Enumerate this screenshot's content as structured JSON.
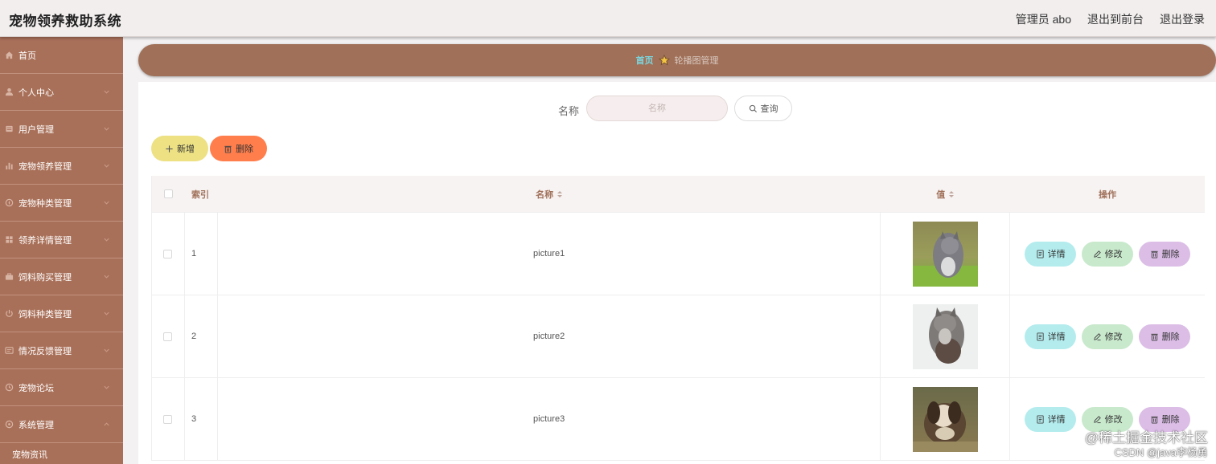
{
  "header": {
    "title": "宠物领养救助系统",
    "admin_label": "管理员 abo",
    "front_label": "退出到前台",
    "logout_label": "退出登录"
  },
  "sidebar": {
    "items": [
      {
        "label": "首页",
        "icon": "home-icon",
        "has_children": false
      },
      {
        "label": "个人中心",
        "icon": "user-icon",
        "has_children": true
      },
      {
        "label": "用户管理",
        "icon": "user-manage-icon",
        "has_children": true
      },
      {
        "label": "宠物领养管理",
        "icon": "bar-chart-icon",
        "has_children": true
      },
      {
        "label": "宠物种类管理",
        "icon": "compass-icon",
        "has_children": true
      },
      {
        "label": "领养详情管理",
        "icon": "grid-icon",
        "has_children": true
      },
      {
        "label": "饲料购买管理",
        "icon": "briefcase-icon",
        "has_children": true
      },
      {
        "label": "饲料种类管理",
        "icon": "power-icon",
        "has_children": true
      },
      {
        "label": "情况反馈管理",
        "icon": "message-icon",
        "has_children": true
      },
      {
        "label": "宠物论坛",
        "icon": "clock-icon",
        "has_children": true
      },
      {
        "label": "系统管理",
        "icon": "settings-icon",
        "has_children": true,
        "expanded": true
      }
    ],
    "sub_items": [
      {
        "label": "宠物资讯"
      }
    ]
  },
  "breadcrumb": {
    "home": "首页",
    "current": "轮播图管理",
    "separator_icon": "star-icon"
  },
  "search": {
    "label": "名称",
    "placeholder": "名称",
    "value": "",
    "button_label": "查询"
  },
  "actions": {
    "add_label": "新增",
    "delete_label": "删除"
  },
  "table": {
    "columns": [
      "索引",
      "名称",
      "值",
      "操作"
    ],
    "rows": [
      {
        "index": "1",
        "name": "picture1",
        "value": "cat-photo"
      },
      {
        "index": "2",
        "name": "picture2",
        "value": "cat-photo"
      },
      {
        "index": "3",
        "name": "picture3",
        "value": "dog-photo"
      }
    ],
    "row_actions": {
      "detail": "详情",
      "edit": "修改",
      "delete": "删除"
    }
  },
  "watermark": {
    "line1": "@稀土掘金技术社区",
    "line2": "CSDN @java李杨勇"
  },
  "colors": {
    "sidebar_bg": "#a97059",
    "breadcrumb_bg": "#a07058",
    "breadcrumb_home": "#7ad7e0",
    "add_button": "#ede184",
    "delete_button": "#ff7e4c",
    "detail_button": "#b4ecee",
    "edit_button": "#c8e9cc",
    "row_delete_button": "#dbbde6",
    "table_header_text": "#a0705a"
  }
}
